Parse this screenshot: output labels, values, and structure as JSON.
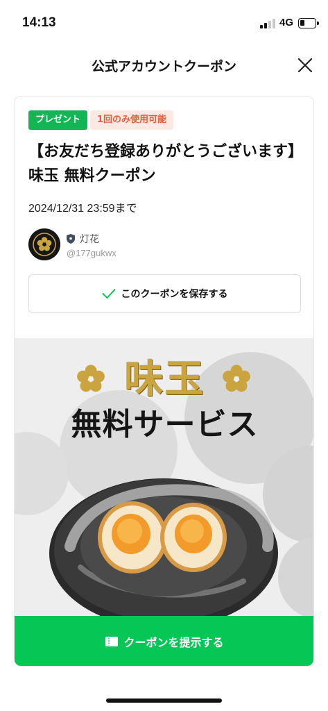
{
  "status_bar": {
    "time": "14:13",
    "network": "4G"
  },
  "header": {
    "title": "公式アカウントクーポン"
  },
  "coupon": {
    "tags": {
      "present": "プレゼント",
      "once": "1回のみ使用可能"
    },
    "title": "【お友だち登録ありがとうございます】味玉 無料クーポン",
    "expiry": "2024/12/31 23:59まで",
    "account": {
      "name": "灯花",
      "id": "@177gukwx"
    },
    "save_label": "このクーポンを保存する",
    "image": {
      "headline": "味玉",
      "subheadline": "無料サービス"
    },
    "show_label": "クーポンを提示する"
  },
  "colors": {
    "accent": "#06c755",
    "tag_green": "#14b555",
    "tag_orange": "#e45d3c",
    "gold": "#c9a43f"
  }
}
